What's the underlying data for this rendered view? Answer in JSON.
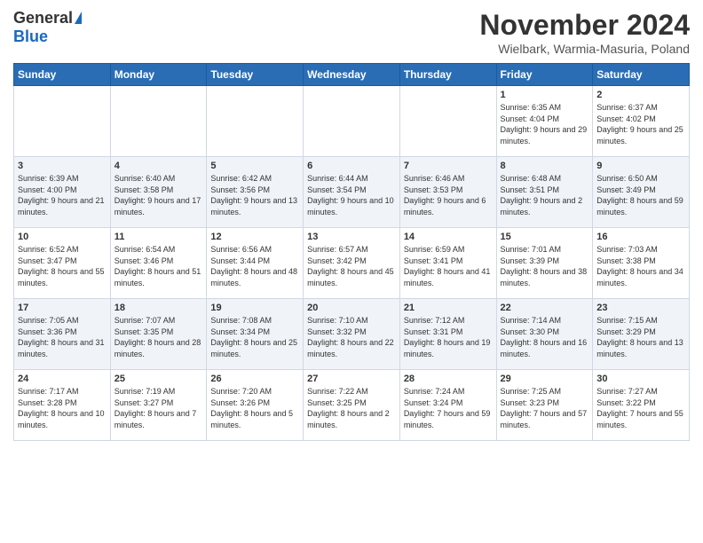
{
  "header": {
    "logo_general": "General",
    "logo_blue": "Blue",
    "title": "November 2024",
    "subtitle": "Wielbark, Warmia-Masuria, Poland"
  },
  "weekdays": [
    "Sunday",
    "Monday",
    "Tuesday",
    "Wednesday",
    "Thursday",
    "Friday",
    "Saturday"
  ],
  "weeks": [
    [
      {
        "day": "",
        "info": ""
      },
      {
        "day": "",
        "info": ""
      },
      {
        "day": "",
        "info": ""
      },
      {
        "day": "",
        "info": ""
      },
      {
        "day": "",
        "info": ""
      },
      {
        "day": "1",
        "info": "Sunrise: 6:35 AM\nSunset: 4:04 PM\nDaylight: 9 hours and 29 minutes."
      },
      {
        "day": "2",
        "info": "Sunrise: 6:37 AM\nSunset: 4:02 PM\nDaylight: 9 hours and 25 minutes."
      }
    ],
    [
      {
        "day": "3",
        "info": "Sunrise: 6:39 AM\nSunset: 4:00 PM\nDaylight: 9 hours and 21 minutes."
      },
      {
        "day": "4",
        "info": "Sunrise: 6:40 AM\nSunset: 3:58 PM\nDaylight: 9 hours and 17 minutes."
      },
      {
        "day": "5",
        "info": "Sunrise: 6:42 AM\nSunset: 3:56 PM\nDaylight: 9 hours and 13 minutes."
      },
      {
        "day": "6",
        "info": "Sunrise: 6:44 AM\nSunset: 3:54 PM\nDaylight: 9 hours and 10 minutes."
      },
      {
        "day": "7",
        "info": "Sunrise: 6:46 AM\nSunset: 3:53 PM\nDaylight: 9 hours and 6 minutes."
      },
      {
        "day": "8",
        "info": "Sunrise: 6:48 AM\nSunset: 3:51 PM\nDaylight: 9 hours and 2 minutes."
      },
      {
        "day": "9",
        "info": "Sunrise: 6:50 AM\nSunset: 3:49 PM\nDaylight: 8 hours and 59 minutes."
      }
    ],
    [
      {
        "day": "10",
        "info": "Sunrise: 6:52 AM\nSunset: 3:47 PM\nDaylight: 8 hours and 55 minutes."
      },
      {
        "day": "11",
        "info": "Sunrise: 6:54 AM\nSunset: 3:46 PM\nDaylight: 8 hours and 51 minutes."
      },
      {
        "day": "12",
        "info": "Sunrise: 6:56 AM\nSunset: 3:44 PM\nDaylight: 8 hours and 48 minutes."
      },
      {
        "day": "13",
        "info": "Sunrise: 6:57 AM\nSunset: 3:42 PM\nDaylight: 8 hours and 45 minutes."
      },
      {
        "day": "14",
        "info": "Sunrise: 6:59 AM\nSunset: 3:41 PM\nDaylight: 8 hours and 41 minutes."
      },
      {
        "day": "15",
        "info": "Sunrise: 7:01 AM\nSunset: 3:39 PM\nDaylight: 8 hours and 38 minutes."
      },
      {
        "day": "16",
        "info": "Sunrise: 7:03 AM\nSunset: 3:38 PM\nDaylight: 8 hours and 34 minutes."
      }
    ],
    [
      {
        "day": "17",
        "info": "Sunrise: 7:05 AM\nSunset: 3:36 PM\nDaylight: 8 hours and 31 minutes."
      },
      {
        "day": "18",
        "info": "Sunrise: 7:07 AM\nSunset: 3:35 PM\nDaylight: 8 hours and 28 minutes."
      },
      {
        "day": "19",
        "info": "Sunrise: 7:08 AM\nSunset: 3:34 PM\nDaylight: 8 hours and 25 minutes."
      },
      {
        "day": "20",
        "info": "Sunrise: 7:10 AM\nSunset: 3:32 PM\nDaylight: 8 hours and 22 minutes."
      },
      {
        "day": "21",
        "info": "Sunrise: 7:12 AM\nSunset: 3:31 PM\nDaylight: 8 hours and 19 minutes."
      },
      {
        "day": "22",
        "info": "Sunrise: 7:14 AM\nSunset: 3:30 PM\nDaylight: 8 hours and 16 minutes."
      },
      {
        "day": "23",
        "info": "Sunrise: 7:15 AM\nSunset: 3:29 PM\nDaylight: 8 hours and 13 minutes."
      }
    ],
    [
      {
        "day": "24",
        "info": "Sunrise: 7:17 AM\nSunset: 3:28 PM\nDaylight: 8 hours and 10 minutes."
      },
      {
        "day": "25",
        "info": "Sunrise: 7:19 AM\nSunset: 3:27 PM\nDaylight: 8 hours and 7 minutes."
      },
      {
        "day": "26",
        "info": "Sunrise: 7:20 AM\nSunset: 3:26 PM\nDaylight: 8 hours and 5 minutes."
      },
      {
        "day": "27",
        "info": "Sunrise: 7:22 AM\nSunset: 3:25 PM\nDaylight: 8 hours and 2 minutes."
      },
      {
        "day": "28",
        "info": "Sunrise: 7:24 AM\nSunset: 3:24 PM\nDaylight: 7 hours and 59 minutes."
      },
      {
        "day": "29",
        "info": "Sunrise: 7:25 AM\nSunset: 3:23 PM\nDaylight: 7 hours and 57 minutes."
      },
      {
        "day": "30",
        "info": "Sunrise: 7:27 AM\nSunset: 3:22 PM\nDaylight: 7 hours and 55 minutes."
      }
    ]
  ]
}
